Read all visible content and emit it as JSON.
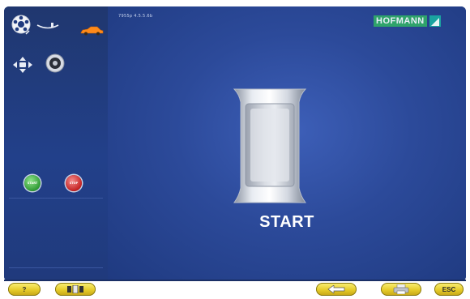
{
  "header": {
    "version": "7955p  4.5.5.6b",
    "logo_text": "HOFMANN"
  },
  "sidebar": {
    "top_icons": [
      "wheel-icon",
      "balance-weight-icon",
      "car-icon"
    ],
    "second_row_icons": [
      "position-arrows-icon",
      "rim-gauge-icon"
    ],
    "start_button_label": "START",
    "stop_button_label": "STOP"
  },
  "main": {
    "start_label": "START"
  },
  "footer": {
    "help_label": "?",
    "esc_label": "ESC",
    "buttons": [
      "help",
      "tools",
      "back",
      "print",
      "esc"
    ]
  },
  "colors": {
    "background": "#1f3a7e",
    "button_yellow": "#e6cc2a",
    "start_green": "#2f9a35",
    "stop_red": "#c42222"
  }
}
